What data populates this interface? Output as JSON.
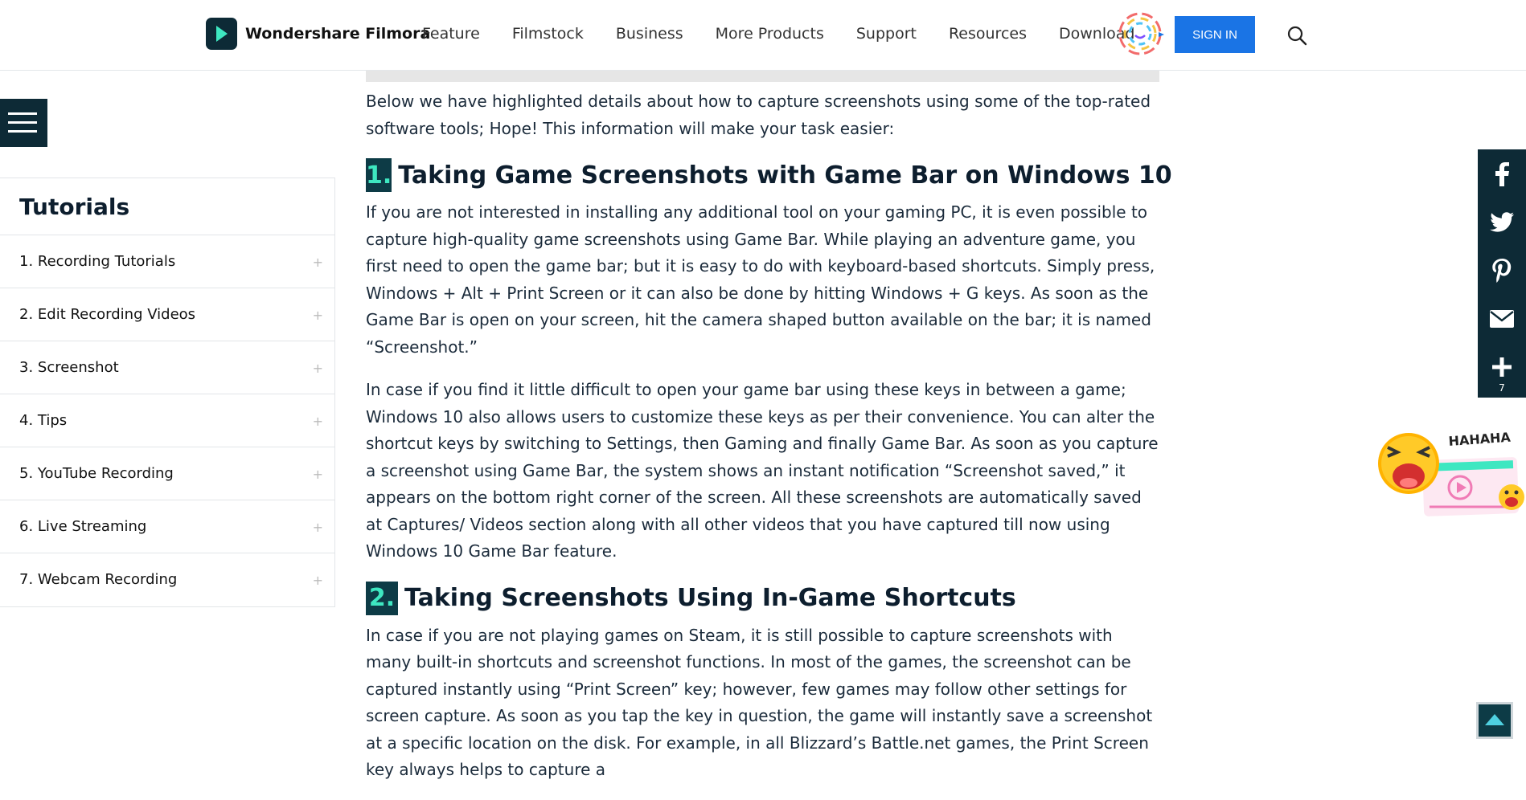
{
  "header": {
    "brand": "Wondershare Filmora",
    "nav": [
      "Feature",
      "Filmstock",
      "Business",
      "More Products",
      "Support",
      "Resources",
      "Download"
    ],
    "signin_label": "SIGN IN"
  },
  "sidebar": {
    "title": "Tutorials",
    "items": [
      {
        "label": "1. Recording Tutorials",
        "plus": "+"
      },
      {
        "label": "2. Edit Recording Videos",
        "plus": "+"
      },
      {
        "label": "3. Screenshot",
        "plus": "+"
      },
      {
        "label": "4. Tips",
        "plus": "+"
      },
      {
        "label": "5. YouTube Recording",
        "plus": "+"
      },
      {
        "label": "6. Live Streaming",
        "plus": "+"
      },
      {
        "label": "7. Webcam Recording",
        "plus": "+"
      }
    ]
  },
  "article": {
    "intro": "Below we have highlighted details about how to capture screenshots using some of the top-rated software tools; Hope! This information will make your task easier:",
    "sections": [
      {
        "number": "1.",
        "heading": "Taking Game Screenshots with Game Bar on Windows 10",
        "paragraphs": [
          "If you are not interested in installing any additional tool on your gaming PC, it is even possible to capture high-quality game screenshots using Game Bar. While playing an adventure game, you first need to open the game bar; but it is easy to do with keyboard-based shortcuts. Simply press, Windows + Alt + Print Screen or it can also be done by hitting Windows + G keys. As soon as the Game Bar is open on your screen, hit the camera shaped button available on the bar; it is named “Screenshot.”",
          "In case if you find it little difficult to open your game bar using these keys in between a game; Windows 10 also allows users to customize these keys as per their convenience. You can alter the shortcut keys by switching to Settings, then Gaming and finally Game Bar. As soon as you capture a screenshot using Game Bar, the system shows an instant notification “Screenshot saved,” it appears on the bottom right corner of the screen. All these screenshots are automatically saved at Captures/ Videos section along with all other videos that you have captured till now using Windows 10 Game Bar feature."
        ]
      },
      {
        "number": "2.",
        "heading": "Taking Screenshots Using In-Game Shortcuts",
        "paragraphs": [
          "In case if you are not playing games on Steam, it is still possible to capture screenshots with many built-in shortcuts and screenshot functions. In most of the games, the screenshot can be captured instantly using “Print Screen” key; however, few games may follow other settings for screen capture. As soon as you tap the key in question, the game will instantly save a screenshot at a specific location on the disk. For example, in all Blizzard’s Battle.net games, the Print Screen key always helps to capture a"
        ]
      }
    ]
  },
  "social": {
    "icons": [
      "facebook-icon",
      "twitter-icon",
      "pinterest-icon",
      "mail-icon",
      "plus-icon"
    ],
    "share_count": "7"
  },
  "ad": {
    "caption": "HAHAHA"
  },
  "colors": {
    "navy": "#0d2a36",
    "accent_teal": "#3ee7c1",
    "signin_blue": "#1a74e5"
  }
}
